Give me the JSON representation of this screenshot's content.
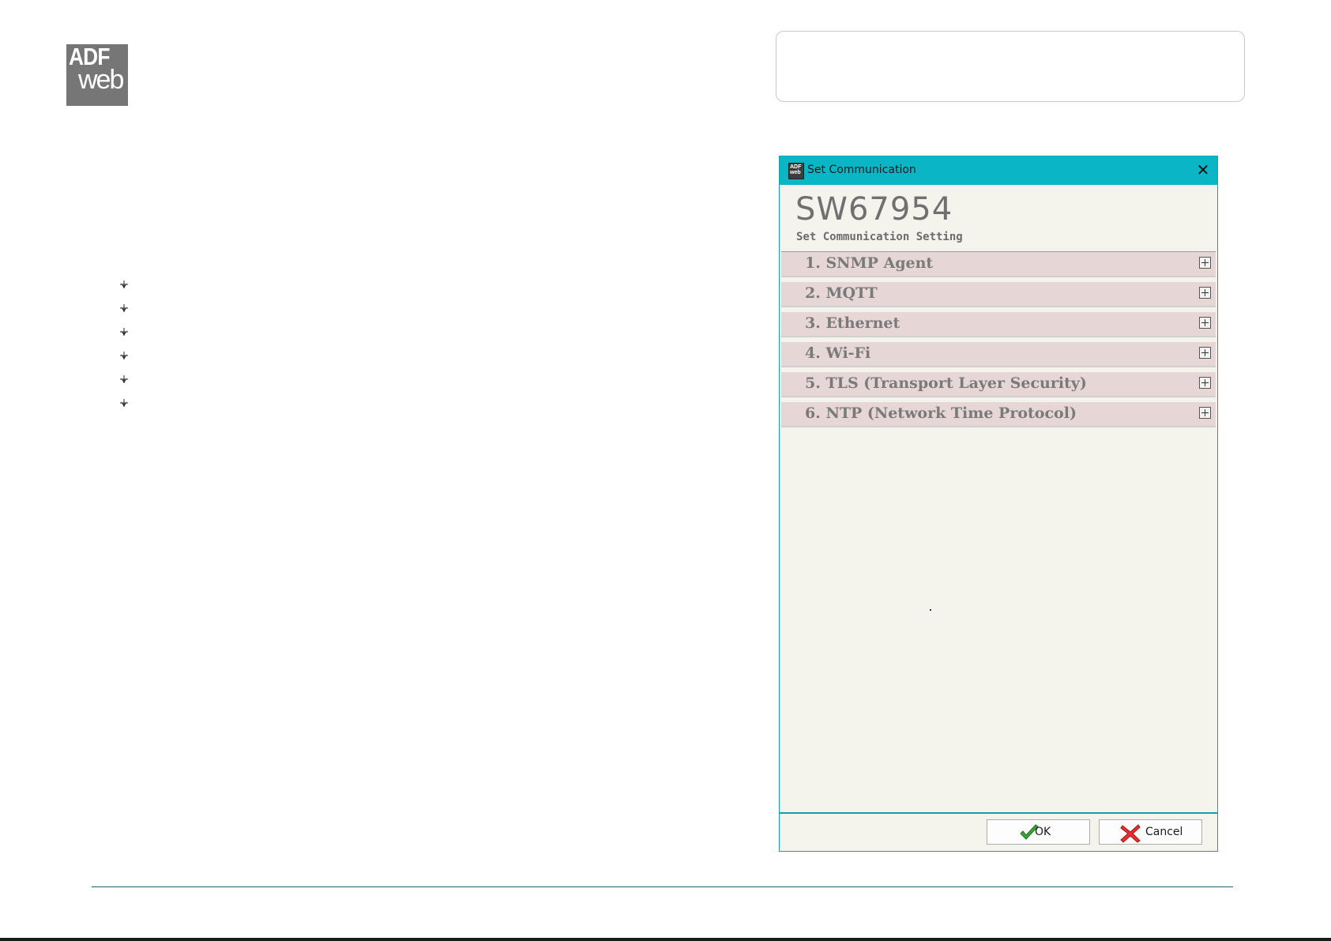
{
  "logo": {
    "line1": "ADF",
    "line2": "web"
  },
  "bullets": {
    "count": 6
  },
  "dialog": {
    "window_title": "Set Communication",
    "close_glyph": "✕",
    "app_icon_text": "ADF web",
    "product_code": "SW67954",
    "subtitle": "Set Communication Setting",
    "sections": [
      {
        "label": "1. SNMP Agent"
      },
      {
        "label": "2. MQTT"
      },
      {
        "label": "3. Ethernet"
      },
      {
        "label": "4. Wi-Fi"
      },
      {
        "label": "5. TLS (Transport Layer Security)"
      },
      {
        "label": "6. NTP (Network Time Protocol)"
      }
    ],
    "ok_label": "OK",
    "cancel_label": "Cancel"
  },
  "colors": {
    "titlebar": "#0ab5c6",
    "dialog_bg": "#f5f4ec",
    "section_bg": "#e7d6d6",
    "ok_icon": "#2e9b2e",
    "cancel_icon": "#e02020"
  }
}
